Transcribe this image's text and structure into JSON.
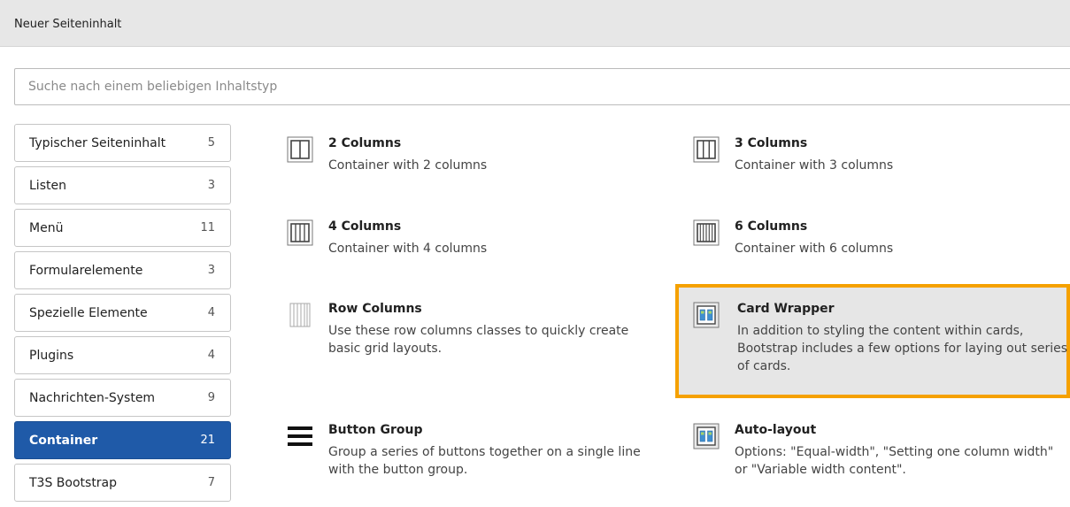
{
  "header": {
    "title": "Neuer Seiteninhalt"
  },
  "search": {
    "placeholder": "Suche nach einem beliebigen Inhaltstyp"
  },
  "sidebar": {
    "items": [
      {
        "label": "Typischer Seiteninhalt",
        "count": "5"
      },
      {
        "label": "Listen",
        "count": "3"
      },
      {
        "label": "Menü",
        "count": "11"
      },
      {
        "label": "Formularelemente",
        "count": "3"
      },
      {
        "label": "Spezielle Elemente",
        "count": "4"
      },
      {
        "label": "Plugins",
        "count": "4"
      },
      {
        "label": "Nachrichten-System",
        "count": "9"
      },
      {
        "label": "Container",
        "count": "21",
        "active": true
      },
      {
        "label": "T3S Bootstrap",
        "count": "7"
      }
    ]
  },
  "content": {
    "items": [
      {
        "icon": "two-columns-icon",
        "title": "2 Columns",
        "description": "Container with 2 columns"
      },
      {
        "icon": "three-columns-icon",
        "title": "3 Columns",
        "description": "Container with 3 columns"
      },
      {
        "icon": "four-columns-icon",
        "title": "4 Columns",
        "description": "Container with 4 columns"
      },
      {
        "icon": "six-columns-icon",
        "title": "6 Columns",
        "description": "Container with 6 columns"
      },
      {
        "icon": "row-columns-icon",
        "title": "Row Columns",
        "description": "Use these row columns classes to quickly create basic grid layouts."
      },
      {
        "icon": "card-wrapper-icon",
        "title": "Card Wrapper",
        "description": "In addition to styling the content within cards, Bootstrap includes a few options for laying out series of cards.",
        "highlighted": true
      },
      {
        "icon": "hamburger-menu-icon",
        "title": "Button Group",
        "description": "Group a series of buttons together on a single line with the button group."
      },
      {
        "icon": "auto-layout-icon",
        "title": "Auto-layout",
        "description": "Options: \"Equal-width\", \"Setting one column width\" or \"Variable width content\"."
      }
    ]
  },
  "colors": {
    "active_tab": "#1f5aa8",
    "highlight_border": "#f5a100",
    "highlight_background": "#e6e6e6"
  }
}
